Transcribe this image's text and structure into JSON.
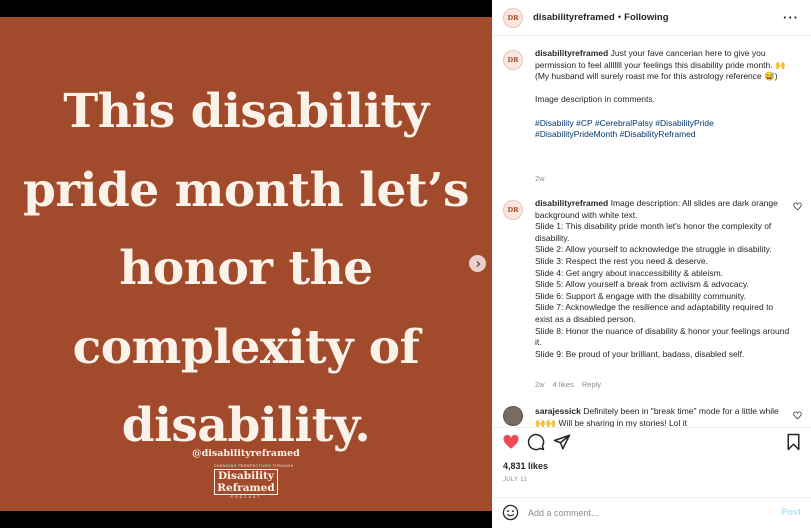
{
  "slide": {
    "lines": [
      "This disability",
      "pride month let’s",
      "honor the",
      "complexity of",
      "disability."
    ],
    "handle": "@disabilityreframed",
    "logo": {
      "top": "CHANGING PERSPECTIVES THROUGH",
      "line1": "Disability",
      "line2": "Reframed",
      "bottom": "PODCAST"
    }
  },
  "header": {
    "avatar": "DR",
    "username": "disabilityreframed",
    "separator": "•",
    "follow": "Following"
  },
  "comments": [
    {
      "username": "disabilityreframed",
      "lines": [
        "Just your fave cancerian here to give you permission to feel alllllll your feelings this disability pride month. 🙌",
        "(My husband will surely roast me for this astrology reference 😅)",
        "",
        "Image description in comments.",
        ""
      ],
      "tags": [
        "#Disability #CP #CerebralPalsy #DisabilityPride",
        "#DisabilityPrideMonth #DisabilityReframed"
      ],
      "time": "2w"
    },
    {
      "username": "disabilityreframed",
      "lines": [
        "Image description: All slides are dark orange background with white text.",
        "Slide 1: This disability pride month let's honor the complexity of disability.",
        "Slide 2: Allow yourself to acknowledge the struggle in disability.",
        "Slide 3: Respect the rest you need & deserve.",
        "Slide 4: Get angry about inaccessibility & ableism.",
        "Slide 5: Allow yourself a break from activism & advocacy.",
        "Slide 6: Support & engage with the disability community.",
        "Slide 7: Acknowledge the resilience and adaptability required to exist as a disabled person.",
        "Slide 8: Honor the nuance of disability & honor your feelings around it.",
        "Slide 9: Be proud of your brilliant, badass, disabled self."
      ],
      "time": "2w",
      "likes": "4 likes",
      "reply": "Reply"
    },
    {
      "username": "sarajessick",
      "text": "Definitely been in \"break time\" mode for a little while 🙌🙌 Will be sharing in my stories! Lol it"
    }
  ],
  "actions": {
    "likes": "4,831 likes",
    "date": "JULY 11"
  },
  "add_comment": {
    "placeholder": "Add a comment...",
    "post": "Post"
  },
  "colors": {
    "slide_bg": "#a24a2c",
    "slide_text": "#fbf3ea",
    "like_red": "#ed4956",
    "link": "#00376b"
  }
}
